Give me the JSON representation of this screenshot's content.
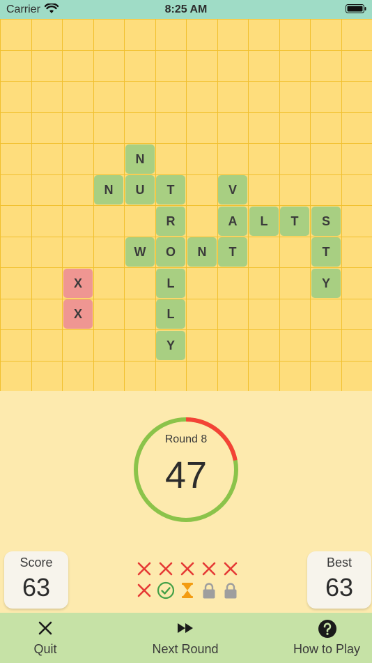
{
  "status_bar": {
    "carrier": "Carrier",
    "time": "8:25 AM"
  },
  "board": {
    "tiles": [
      {
        "letter": "N",
        "col": 4,
        "row": 4,
        "state": "ok"
      },
      {
        "letter": "N",
        "col": 3,
        "row": 5,
        "state": "ok"
      },
      {
        "letter": "U",
        "col": 4,
        "row": 5,
        "state": "ok"
      },
      {
        "letter": "T",
        "col": 5,
        "row": 5,
        "state": "ok"
      },
      {
        "letter": "V",
        "col": 7,
        "row": 5,
        "state": "ok"
      },
      {
        "letter": "R",
        "col": 5,
        "row": 6,
        "state": "ok"
      },
      {
        "letter": "A",
        "col": 7,
        "row": 6,
        "state": "ok"
      },
      {
        "letter": "L",
        "col": 8,
        "row": 6,
        "state": "ok"
      },
      {
        "letter": "T",
        "col": 9,
        "row": 6,
        "state": "ok"
      },
      {
        "letter": "S",
        "col": 10,
        "row": 6,
        "state": "ok"
      },
      {
        "letter": "W",
        "col": 4,
        "row": 7,
        "state": "ok"
      },
      {
        "letter": "O",
        "col": 5,
        "row": 7,
        "state": "ok"
      },
      {
        "letter": "N",
        "col": 6,
        "row": 7,
        "state": "ok"
      },
      {
        "letter": "T",
        "col": 7,
        "row": 7,
        "state": "ok"
      },
      {
        "letter": "T",
        "col": 10,
        "row": 7,
        "state": "ok"
      },
      {
        "letter": "X",
        "col": 2,
        "row": 8,
        "state": "bad"
      },
      {
        "letter": "L",
        "col": 5,
        "row": 8,
        "state": "ok"
      },
      {
        "letter": "Y",
        "col": 10,
        "row": 8,
        "state": "ok"
      },
      {
        "letter": "X",
        "col": 2,
        "row": 9,
        "state": "bad"
      },
      {
        "letter": "L",
        "col": 5,
        "row": 9,
        "state": "ok"
      },
      {
        "letter": "Y",
        "col": 5,
        "row": 10,
        "state": "ok"
      }
    ]
  },
  "round": {
    "label": "Round 8",
    "time_remaining": "47",
    "elapsed_fraction": 0.22,
    "colors": {
      "remaining": "#8bc34a",
      "elapsed": "#f44336"
    }
  },
  "score": {
    "label": "Score",
    "value": "63"
  },
  "best": {
    "label": "Best",
    "value": "63"
  },
  "attempts": [
    {
      "state": "failed"
    },
    {
      "state": "failed"
    },
    {
      "state": "failed"
    },
    {
      "state": "failed"
    },
    {
      "state": "failed"
    },
    {
      "state": "failed"
    },
    {
      "state": "passed"
    },
    {
      "state": "current"
    },
    {
      "state": "locked"
    },
    {
      "state": "locked"
    }
  ],
  "nav": {
    "quit": {
      "label": "Quit",
      "icon": "close-icon"
    },
    "next_round": {
      "label": "Next Round",
      "icon": "fast-forward-icon"
    },
    "how_to_play": {
      "label": "How to Play",
      "icon": "help-icon"
    }
  }
}
